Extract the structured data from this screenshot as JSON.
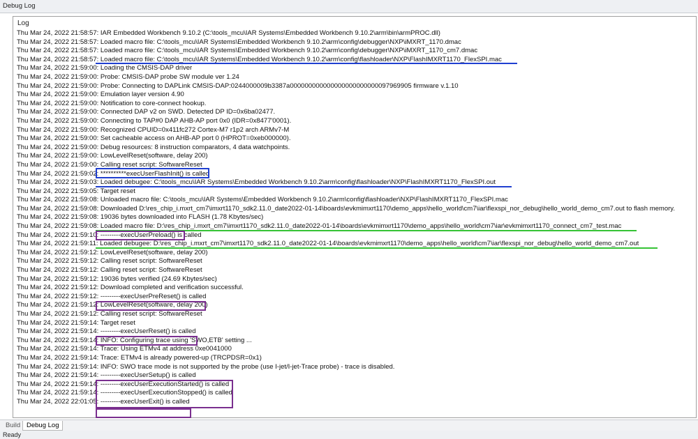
{
  "window": {
    "title": "Debug Log"
  },
  "panel": {
    "header": "Log"
  },
  "log": [
    "Thu Mar 24, 2022 21:58:57: IAR Embedded Workbench 9.10.2 (C:\\tools_mcu\\IAR Systems\\Embedded Workbench 9.10.2\\arm\\bin\\armPROC.dll)",
    "Thu Mar 24, 2022 21:58:57: Loaded macro file: C:\\tools_mcu\\IAR Systems\\Embedded Workbench 9.10.2\\arm\\config\\debugger\\NXP\\iMXRT_1170.dmac",
    "Thu Mar 24, 2022 21:58:57: Loaded macro file: C:\\tools_mcu\\IAR Systems\\Embedded Workbench 9.10.2\\arm\\config\\debugger\\NXP\\iMXRT_1170_cm7.dmac",
    "Thu Mar 24, 2022 21:58:57: Loaded macro file: C:\\tools_mcu\\IAR Systems\\Embedded Workbench 9.10.2\\arm\\config\\flashloader\\NXP\\FlashIMXRT1170_FlexSPI.mac",
    "Thu Mar 24, 2022 21:59:00: Loading the CMSIS-DAP driver",
    "Thu Mar 24, 2022 21:59:00: Probe: CMSIS-DAP probe SW module ver 1.24",
    "Thu Mar 24, 2022 21:59:00: Probe: Connecting to DAPLink CMSIS-DAP:0244000009b3387a000000000000000000000000097969905 firmware v.1.10",
    "Thu Mar 24, 2022 21:59:00: Emulation layer version 4.90",
    "Thu Mar 24, 2022 21:59:00: Notification to core-connect hookup.",
    "Thu Mar 24, 2022 21:59:00: Connected DAP v2 on SWD. Detected DP ID=0x6ba02477.",
    "Thu Mar 24, 2022 21:59:00: Connecting to TAP#0 DAP AHB-AP port 0x0 (IDR=0x8477'0001).",
    "Thu Mar 24, 2022 21:59:00: Recognized CPUID=0x411fc272 Cortex-M7 r1p2 arch ARMv7-M",
    "Thu Mar 24, 2022 21:59:00: Set cacheable access on AHB-AP port 0 (HPROT=0xeb000000).",
    "Thu Mar 24, 2022 21:59:00: Debug resources: 8 instruction comparators, 4 data watchpoints.",
    "Thu Mar 24, 2022 21:59:00: LowLevelReset(software, delay 200)",
    "Thu Mar 24, 2022 21:59:00: Calling reset script: SoftwareReset",
    "Thu Mar 24, 2022 21:59:02: **********execUserFlashInit() is called",
    "Thu Mar 24, 2022 21:59:03: Loaded debugee: C:\\tools_mcu\\IAR Systems\\Embedded Workbench 9.10.2\\arm\\config\\flashloader\\NXP\\FlashIMXRT1170_FlexSPI.out",
    "Thu Mar 24, 2022 21:59:05: Target reset",
    "Thu Mar 24, 2022 21:59:08: Unloaded macro file: C:\\tools_mcu\\IAR Systems\\Embedded Workbench 9.10.2\\arm\\config\\flashloader\\NXP\\FlashIMXRT1170_FlexSPI.mac",
    "Thu Mar 24, 2022 21:59:08: Downloaded D:\\res_chip_i.mxrt_cm7\\imxrt1170_sdk2.11.0_date2022-01-14\\boards\\evkmimxrt1170\\demo_apps\\hello_world\\cm7\\iar\\flexspi_nor_debug\\hello_world_demo_cm7.out to flash memory.",
    "Thu Mar 24, 2022 21:59:08: 19036 bytes downloaded into FLASH (1.78 Kbytes/sec)",
    "Thu Mar 24, 2022 21:59:08: Loaded macro file: D:\\res_chip_i.mxrt_cm7\\imxrt1170_sdk2.11.0_date2022-01-14\\boards\\evkmimxrt1170\\demo_apps\\hello_world\\cm7\\iar\\evkmimxrt1170_connect_cm7_test.mac",
    "Thu Mar 24, 2022 21:59:10: ---------execUserPreload() is called",
    "Thu Mar 24, 2022 21:59:11: Loaded debugee: D:\\res_chip_i.mxrt_cm7\\imxrt1170_sdk2.11.0_date2022-01-14\\boards\\evkmimxrt1170\\demo_apps\\hello_world\\cm7\\iar\\flexspi_nor_debug\\hello_world_demo_cm7.out",
    "Thu Mar 24, 2022 21:59:12: LowLevelReset(software, delay 200)",
    "Thu Mar 24, 2022 21:59:12: Calling reset script: SoftwareReset",
    "Thu Mar 24, 2022 21:59:12: Calling reset script: SoftwareReset",
    "Thu Mar 24, 2022 21:59:12: 19036 bytes verified (24.69 Kbytes/sec)",
    "Thu Mar 24, 2022 21:59:12: Download completed and verification successful.",
    "Thu Mar 24, 2022 21:59:12: ---------execUserPreReset() is called",
    "Thu Mar 24, 2022 21:59:12: LowLevelReset(software, delay 200)",
    "Thu Mar 24, 2022 21:59:12: Calling reset script: SoftwareReset",
    "Thu Mar 24, 2022 21:59:14: Target reset",
    "Thu Mar 24, 2022 21:59:14: ---------execUserReset() is called",
    "Thu Mar 24, 2022 21:59:14: INFO: Configuring trace using 'SWO,ETB' setting ...",
    "Thu Mar 24, 2022 21:59:14: Trace: Using ETMv4 at address 0xe0041000",
    "Thu Mar 24, 2022 21:59:14: Trace: ETMv4 is already powered-up (TRCPDSR=0x1)",
    "Thu Mar 24, 2022 21:59:14: INFO: SWO trace mode is not supported by the probe (use I-jet/I-jet-Trace probe) - trace is disabled.",
    "Thu Mar 24, 2022 21:59:14: ---------execUserSetup() is called",
    "Thu Mar 24, 2022 21:59:14: ---------execUserExecutionStarted() is called",
    "Thu Mar 24, 2022 21:59:14: ---------execUserExecutionStopped() is called",
    "Thu Mar 24, 2022 22:01:05: ---------execUserExit() is called"
  ],
  "tabs": [
    {
      "label": "Build",
      "active": false
    },
    {
      "label": "Debug Log",
      "active": true
    }
  ],
  "status": {
    "text": "Ready"
  },
  "colors": {
    "annotation_blue": "#1f3fd0",
    "annotation_purple": "#7a2f8f",
    "annotation_green": "#35c335"
  }
}
